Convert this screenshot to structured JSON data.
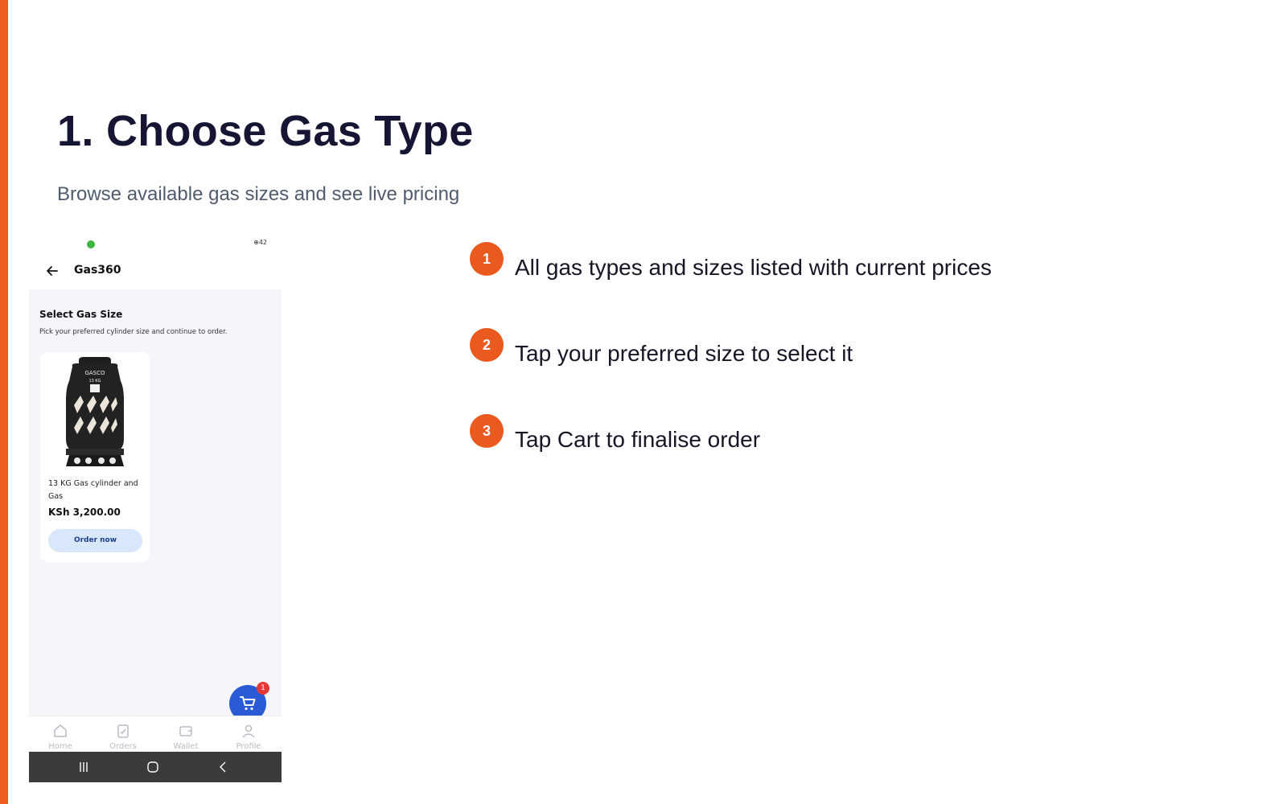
{
  "colors": {
    "accent": "#ee5e21",
    "title": "#161634",
    "subtitle": "#4f5b6e",
    "primary_blue": "#2a5bd7",
    "badge_red": "#e53935"
  },
  "slide": {
    "title": "1.  Choose Gas Type",
    "subtitle": "Browse available gas sizes and see live pricing"
  },
  "phone": {
    "status_right": "⊕42",
    "header": {
      "back_icon": "arrow-left-icon",
      "title": "Gas360"
    },
    "section": {
      "title": "Select Gas Size",
      "subtitle": "Pick your preferred cylinder size and continue to order."
    },
    "products": [
      {
        "name": "13 KG Gas cylinder and Gas",
        "price": "KSh 3,200.00",
        "button": "Order now",
        "brand": "GASCO",
        "weight": "13 KG"
      }
    ],
    "cart": {
      "icon": "cart-icon",
      "count": "1"
    },
    "bottom_nav": [
      {
        "label": "Home",
        "icon": "home-icon"
      },
      {
        "label": "Orders",
        "icon": "orders-icon"
      },
      {
        "label": "Wallet",
        "icon": "wallet-icon"
      },
      {
        "label": "Profile",
        "icon": "profile-icon"
      }
    ]
  },
  "steps": [
    {
      "number": "1",
      "text": "All gas types and sizes listed with current prices"
    },
    {
      "number": "2",
      "text": "Tap your preferred size to select it"
    },
    {
      "number": "3",
      "text": "Tap Cart  to finalise order"
    }
  ]
}
